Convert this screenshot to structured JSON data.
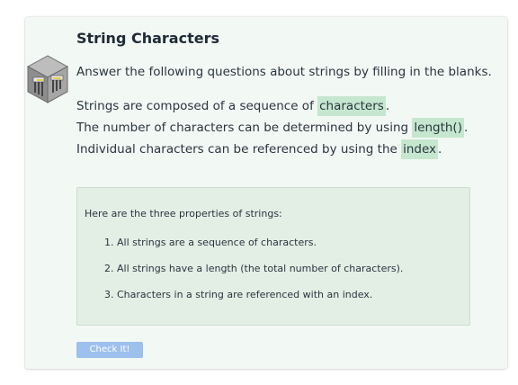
{
  "card": {
    "title": "String Characters",
    "intro": "Answer the following questions about strings by filling in the blanks."
  },
  "questions": [
    {
      "before": "Strings are composed of a sequence of ",
      "answer": "characters",
      "after": "."
    },
    {
      "before": "The number of characters can be determined by using ",
      "answer": "length()",
      "after": "."
    },
    {
      "before": "Individual characters can be referenced by using the ",
      "answer": "index",
      "after": "."
    }
  ],
  "info": {
    "lead": "Here are the three properties of strings:",
    "items": [
      "1. All strings are a sequence of characters.",
      "2. All strings have a length (the total number of characters).",
      "3. Characters in a string are referenced with an index."
    ]
  },
  "check_button": {
    "label": "Check It!"
  },
  "colors": {
    "card_bg": "#f2f8f4",
    "blank_highlight": "#c6e7cf",
    "info_bg": "#e3efe5",
    "button_bg": "#9dc0ed"
  },
  "icons": {
    "logo": "cube-with-pipes-icon"
  }
}
